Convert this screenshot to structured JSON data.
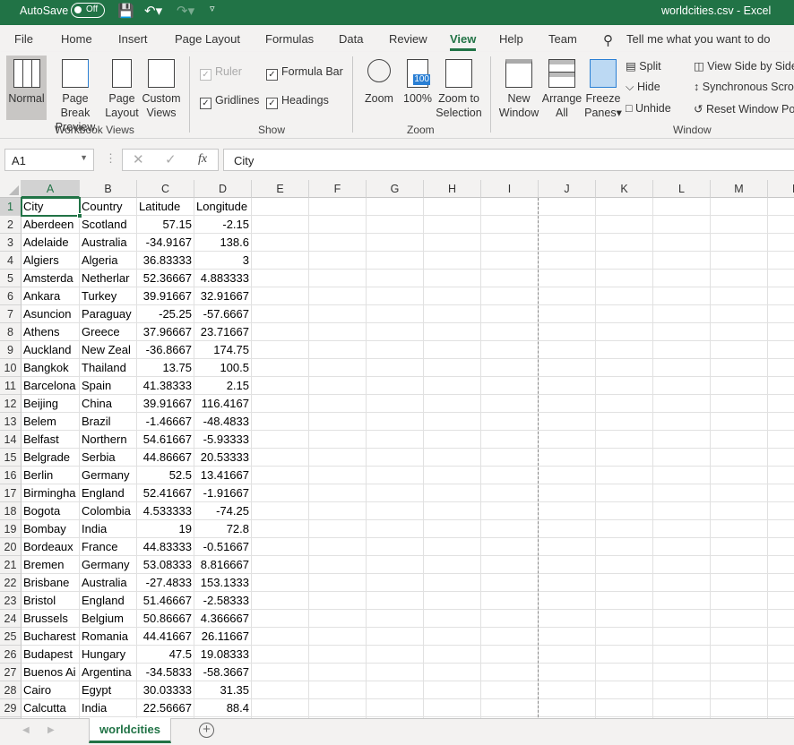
{
  "titlebar": {
    "autosave_label": "AutoSave",
    "autosave_state": "Off",
    "title": "worldcities.csv  -  Excel"
  },
  "menu": {
    "tabs": [
      "File",
      "Home",
      "Insert",
      "Page Layout",
      "Formulas",
      "Data",
      "Review",
      "View",
      "Help",
      "Team"
    ],
    "active": "View",
    "search": "Tell me what you want to do"
  },
  "ribbon": {
    "workbook_views": {
      "label": "Workbook Views",
      "normal": "Normal",
      "page_break_1": "Page Break",
      "page_break_2": "Preview",
      "page_layout_1": "Page",
      "page_layout_2": "Layout",
      "custom_1": "Custom",
      "custom_2": "Views"
    },
    "show": {
      "label": "Show",
      "ruler": "Ruler",
      "formula_bar": "Formula Bar",
      "gridlines": "Gridlines",
      "headings": "Headings"
    },
    "zoom": {
      "label": "Zoom",
      "zoom": "Zoom",
      "hundred": "100%",
      "sel_1": "Zoom to",
      "sel_2": "Selection",
      "icon_text": "100"
    },
    "window": {
      "label": "Window",
      "new_1": "New",
      "new_2": "Window",
      "arrange_1": "Arrange",
      "arrange_2": "All",
      "freeze_1": "Freeze",
      "freeze_2": "Panes",
      "split": "Split",
      "hide": "Hide",
      "unhide": "Unhide",
      "side_by_side": "View Side by Side",
      "sync": "Synchronous Scro",
      "reset": "Reset Window Po"
    }
  },
  "formula_bar": {
    "name_box": "A1",
    "fx": "fx",
    "value": "City"
  },
  "columns": [
    "A",
    "B",
    "C",
    "D",
    "E",
    "F",
    "G",
    "H",
    "I",
    "J",
    "K",
    "L",
    "M",
    "N"
  ],
  "rows": [
    [
      "City",
      "Country",
      "Latitude",
      "Longitude"
    ],
    [
      "Aberdeen",
      "Scotland",
      "57.15",
      "-2.15"
    ],
    [
      "Adelaide",
      "Australia",
      "-34.9167",
      "138.6"
    ],
    [
      "Algiers",
      "Algeria",
      "36.83333",
      "3"
    ],
    [
      "Amsterda",
      "Netherlar",
      "52.36667",
      "4.883333"
    ],
    [
      "Ankara",
      "Turkey",
      "39.91667",
      "32.91667"
    ],
    [
      "Asuncion",
      "Paraguay",
      "-25.25",
      "-57.6667"
    ],
    [
      "Athens",
      "Greece",
      "37.96667",
      "23.71667"
    ],
    [
      "Auckland",
      "New Zeal",
      "-36.8667",
      "174.75"
    ],
    [
      "Bangkok",
      "Thailand",
      "13.75",
      "100.5"
    ],
    [
      "Barcelona",
      "Spain",
      "41.38333",
      "2.15"
    ],
    [
      "Beijing",
      "China",
      "39.91667",
      "116.4167"
    ],
    [
      "Belem",
      "Brazil",
      "-1.46667",
      "-48.4833"
    ],
    [
      "Belfast",
      "Northern",
      "54.61667",
      "-5.93333"
    ],
    [
      "Belgrade",
      "Serbia",
      "44.86667",
      "20.53333"
    ],
    [
      "Berlin",
      "Germany",
      "52.5",
      "13.41667"
    ],
    [
      "Birmingha",
      "England",
      "52.41667",
      "-1.91667"
    ],
    [
      "Bogota",
      "Colombia",
      "4.533333",
      "-74.25"
    ],
    [
      "Bombay",
      "India",
      "19",
      "72.8"
    ],
    [
      "Bordeaux",
      "France",
      "44.83333",
      "-0.51667"
    ],
    [
      "Bremen",
      "Germany",
      "53.08333",
      "8.816667"
    ],
    [
      "Brisbane",
      "Australia",
      "-27.4833",
      "153.1333"
    ],
    [
      "Bristol",
      "England",
      "51.46667",
      "-2.58333"
    ],
    [
      "Brussels",
      "Belgium",
      "50.86667",
      "4.366667"
    ],
    [
      "Bucharest",
      "Romania",
      "44.41667",
      "26.11667"
    ],
    [
      "Budapest",
      "Hungary",
      "47.5",
      "19.08333"
    ],
    [
      "Buenos Ai",
      "Argentina",
      "-34.5833",
      "-58.3667"
    ],
    [
      "Cairo",
      "Egypt",
      "30.03333",
      "31.35"
    ],
    [
      "Calcutta",
      "India",
      "22.56667",
      "88.4"
    ]
  ],
  "sheets": [
    "worldcities"
  ],
  "colors": {
    "accent": "#217346"
  }
}
